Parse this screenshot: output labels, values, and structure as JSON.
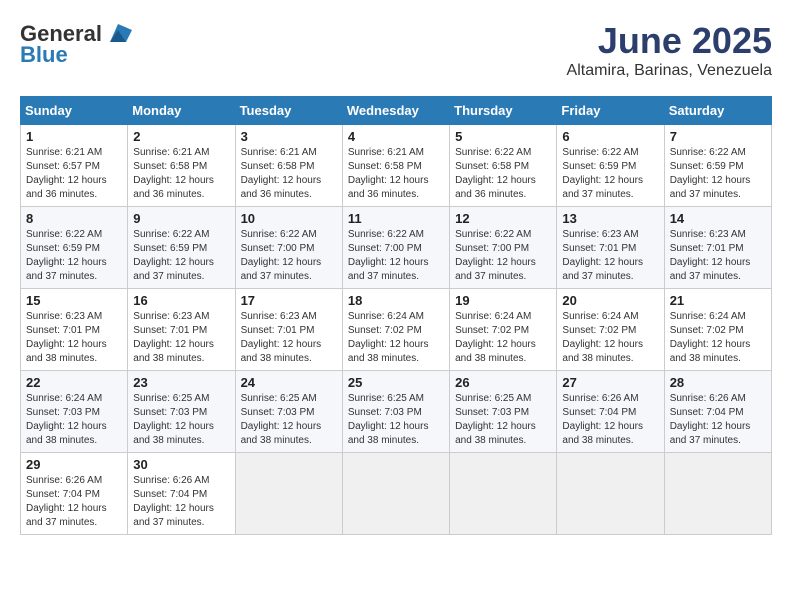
{
  "logo": {
    "general": "General",
    "blue": "Blue"
  },
  "header": {
    "month": "June 2025",
    "location": "Altamira, Barinas, Venezuela"
  },
  "weekdays": [
    "Sunday",
    "Monday",
    "Tuesday",
    "Wednesday",
    "Thursday",
    "Friday",
    "Saturday"
  ],
  "weeks": [
    [
      {
        "day": "1",
        "info": "Sunrise: 6:21 AM\nSunset: 6:57 PM\nDaylight: 12 hours\nand 36 minutes."
      },
      {
        "day": "2",
        "info": "Sunrise: 6:21 AM\nSunset: 6:58 PM\nDaylight: 12 hours\nand 36 minutes."
      },
      {
        "day": "3",
        "info": "Sunrise: 6:21 AM\nSunset: 6:58 PM\nDaylight: 12 hours\nand 36 minutes."
      },
      {
        "day": "4",
        "info": "Sunrise: 6:21 AM\nSunset: 6:58 PM\nDaylight: 12 hours\nand 36 minutes."
      },
      {
        "day": "5",
        "info": "Sunrise: 6:22 AM\nSunset: 6:58 PM\nDaylight: 12 hours\nand 36 minutes."
      },
      {
        "day": "6",
        "info": "Sunrise: 6:22 AM\nSunset: 6:59 PM\nDaylight: 12 hours\nand 37 minutes."
      },
      {
        "day": "7",
        "info": "Sunrise: 6:22 AM\nSunset: 6:59 PM\nDaylight: 12 hours\nand 37 minutes."
      }
    ],
    [
      {
        "day": "8",
        "info": "Sunrise: 6:22 AM\nSunset: 6:59 PM\nDaylight: 12 hours\nand 37 minutes."
      },
      {
        "day": "9",
        "info": "Sunrise: 6:22 AM\nSunset: 6:59 PM\nDaylight: 12 hours\nand 37 minutes."
      },
      {
        "day": "10",
        "info": "Sunrise: 6:22 AM\nSunset: 7:00 PM\nDaylight: 12 hours\nand 37 minutes."
      },
      {
        "day": "11",
        "info": "Sunrise: 6:22 AM\nSunset: 7:00 PM\nDaylight: 12 hours\nand 37 minutes."
      },
      {
        "day": "12",
        "info": "Sunrise: 6:22 AM\nSunset: 7:00 PM\nDaylight: 12 hours\nand 37 minutes."
      },
      {
        "day": "13",
        "info": "Sunrise: 6:23 AM\nSunset: 7:01 PM\nDaylight: 12 hours\nand 37 minutes."
      },
      {
        "day": "14",
        "info": "Sunrise: 6:23 AM\nSunset: 7:01 PM\nDaylight: 12 hours\nand 37 minutes."
      }
    ],
    [
      {
        "day": "15",
        "info": "Sunrise: 6:23 AM\nSunset: 7:01 PM\nDaylight: 12 hours\nand 38 minutes."
      },
      {
        "day": "16",
        "info": "Sunrise: 6:23 AM\nSunset: 7:01 PM\nDaylight: 12 hours\nand 38 minutes."
      },
      {
        "day": "17",
        "info": "Sunrise: 6:23 AM\nSunset: 7:01 PM\nDaylight: 12 hours\nand 38 minutes."
      },
      {
        "day": "18",
        "info": "Sunrise: 6:24 AM\nSunset: 7:02 PM\nDaylight: 12 hours\nand 38 minutes."
      },
      {
        "day": "19",
        "info": "Sunrise: 6:24 AM\nSunset: 7:02 PM\nDaylight: 12 hours\nand 38 minutes."
      },
      {
        "day": "20",
        "info": "Sunrise: 6:24 AM\nSunset: 7:02 PM\nDaylight: 12 hours\nand 38 minutes."
      },
      {
        "day": "21",
        "info": "Sunrise: 6:24 AM\nSunset: 7:02 PM\nDaylight: 12 hours\nand 38 minutes."
      }
    ],
    [
      {
        "day": "22",
        "info": "Sunrise: 6:24 AM\nSunset: 7:03 PM\nDaylight: 12 hours\nand 38 minutes."
      },
      {
        "day": "23",
        "info": "Sunrise: 6:25 AM\nSunset: 7:03 PM\nDaylight: 12 hours\nand 38 minutes."
      },
      {
        "day": "24",
        "info": "Sunrise: 6:25 AM\nSunset: 7:03 PM\nDaylight: 12 hours\nand 38 minutes."
      },
      {
        "day": "25",
        "info": "Sunrise: 6:25 AM\nSunset: 7:03 PM\nDaylight: 12 hours\nand 38 minutes."
      },
      {
        "day": "26",
        "info": "Sunrise: 6:25 AM\nSunset: 7:03 PM\nDaylight: 12 hours\nand 38 minutes."
      },
      {
        "day": "27",
        "info": "Sunrise: 6:26 AM\nSunset: 7:04 PM\nDaylight: 12 hours\nand 38 minutes."
      },
      {
        "day": "28",
        "info": "Sunrise: 6:26 AM\nSunset: 7:04 PM\nDaylight: 12 hours\nand 37 minutes."
      }
    ],
    [
      {
        "day": "29",
        "info": "Sunrise: 6:26 AM\nSunset: 7:04 PM\nDaylight: 12 hours\nand 37 minutes."
      },
      {
        "day": "30",
        "info": "Sunrise: 6:26 AM\nSunset: 7:04 PM\nDaylight: 12 hours\nand 37 minutes."
      },
      {
        "day": "",
        "info": ""
      },
      {
        "day": "",
        "info": ""
      },
      {
        "day": "",
        "info": ""
      },
      {
        "day": "",
        "info": ""
      },
      {
        "day": "",
        "info": ""
      }
    ]
  ]
}
